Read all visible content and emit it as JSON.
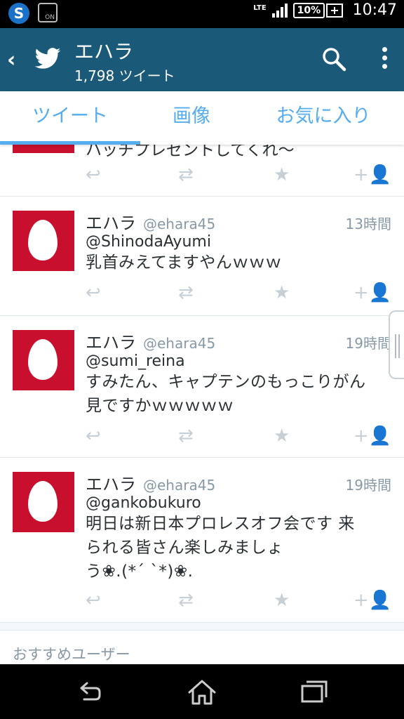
{
  "status": {
    "carrier_icon": "s-icon",
    "network": "LTE",
    "battery": "10%",
    "time": "10:47"
  },
  "appbar": {
    "title": "エハラ",
    "subtitle": "1,798 ツイート"
  },
  "tabs": [
    {
      "label": "ツイート",
      "active": true
    },
    {
      "label": "画像",
      "active": false
    },
    {
      "label": "お気に入り",
      "active": false
    }
  ],
  "partial_tweet": {
    "text": "ハッチプレゼントしてくれ〜"
  },
  "tweets": [
    {
      "name": "エハラ",
      "handle": "@ehara45",
      "time": "13時間",
      "reply_to": "@ShinodaAyumi",
      "lines": [
        "乳首みえてますやんｗｗｗ"
      ]
    },
    {
      "name": "エハラ",
      "handle": "@ehara45",
      "time": "19時間",
      "reply_to": "@sumi_reina",
      "lines": [
        "すみたん、キャプテンのもっこりがん",
        "見ですかｗｗｗｗｗ"
      ]
    },
    {
      "name": "エハラ",
      "handle": "@ehara45",
      "time": "19時間",
      "reply_to": "@gankobukuro",
      "lines": [
        "明日は新日本プロレスオフ会です 来",
        "られる皆さん楽しみましょ",
        "う❀.(*´ `*)❀."
      ]
    }
  ],
  "recommended": {
    "title": "おすすめユーザー"
  },
  "colors": {
    "appbar": "#1a5a78",
    "accent": "#55acee",
    "avatar": "#c8102e"
  }
}
